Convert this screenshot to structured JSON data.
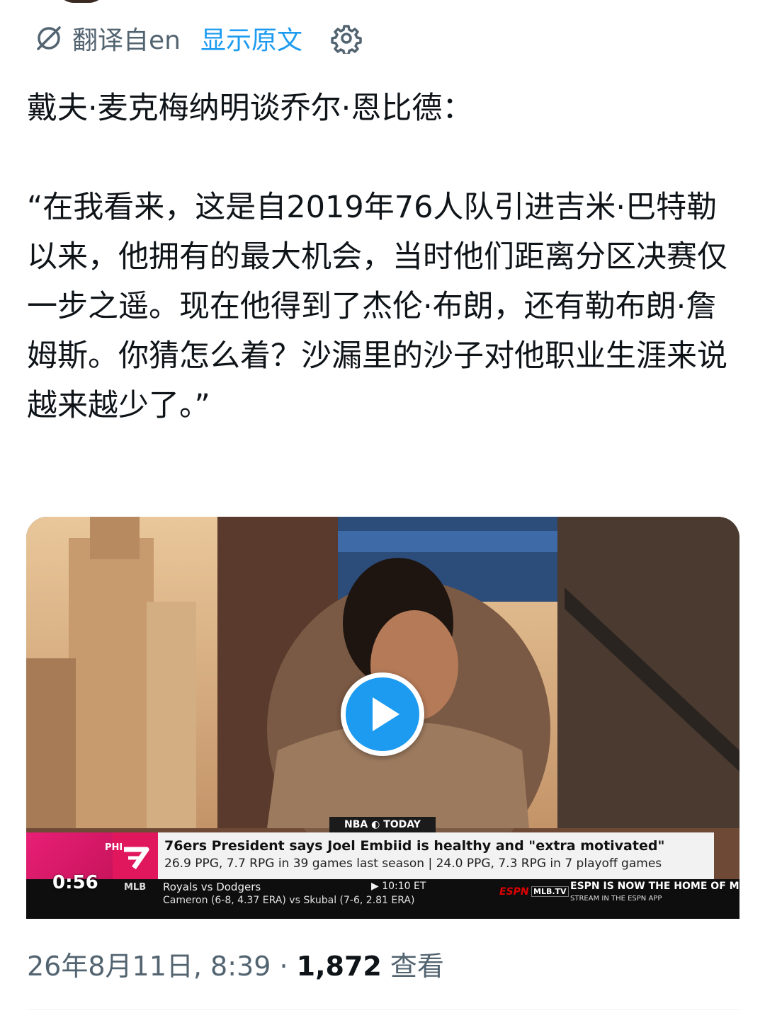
{
  "translation": {
    "label": "翻译自en",
    "show_original": "显示原文"
  },
  "tweet": {
    "text": "戴夫·麦克梅纳明谈乔尔·恩比德：\n\n“在我看来，这是自2019年76人队引进吉米·巴特勒以来，他拥有的最大机会，当时他们距离分区决赛仅一步之遥。现在他得到了杰伦·布朗，还有勒布朗·詹姆斯。你猜怎么着？沙漏里的沙子对他职业生涯来说越来越少了。”"
  },
  "video": {
    "duration": "0:56",
    "show_tag": "NBA ◐ TODAY",
    "team_code": "PHI",
    "headline": "76ers President says Joel Embiid is healthy and \"extra motivated\"",
    "stats_line": "26.9 PPG, 7.7 RPG in 39 games last season  |  24.0 PPG, 7.3 RPG in 7 playoff games",
    "ticker": {
      "league": "MLB",
      "matchup": "Royals vs Dodgers",
      "pitchers": "Cameron (6-8, 4.37 ERA) vs Skubal (7-6, 2.81 ERA)",
      "time": "▶ 10:10 ET",
      "network": "ESPN",
      "mlbtv": "MLB.TV",
      "promo": "ESPN IS NOW THE HOME OF MLB.TV",
      "promo_sub": "STREAM IN THE ESPN APP"
    }
  },
  "meta": {
    "date_time": "26年8月11日, 8:39 · ",
    "views_count": "1,872",
    "views_label": " 查看"
  }
}
